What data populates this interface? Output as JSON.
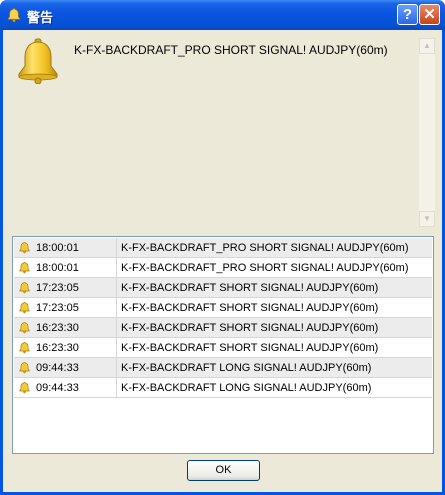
{
  "window": {
    "title": "警告",
    "help_glyph": "?",
    "close_glyph": "✕"
  },
  "alert": {
    "icon": "bell-icon",
    "message": "K-FX-BACKDRAFT_PRO SHORT SIGNAL! AUDJPY(60m)"
  },
  "log": {
    "rows": [
      {
        "time": "18:00:01",
        "text": "K-FX-BACKDRAFT_PRO SHORT SIGNAL! AUDJPY(60m)"
      },
      {
        "time": "18:00:01",
        "text": "K-FX-BACKDRAFT_PRO SHORT SIGNAL! AUDJPY(60m)"
      },
      {
        "time": "17:23:05",
        "text": "K-FX-BACKDRAFT SHORT SIGNAL! AUDJPY(60m)"
      },
      {
        "time": "17:23:05",
        "text": "K-FX-BACKDRAFT SHORT SIGNAL! AUDJPY(60m)"
      },
      {
        "time": "16:23:30",
        "text": "K-FX-BACKDRAFT SHORT SIGNAL! AUDJPY(60m)"
      },
      {
        "time": "16:23:30",
        "text": "K-FX-BACKDRAFT SHORT SIGNAL! AUDJPY(60m)"
      },
      {
        "time": "09:44:33",
        "text": "K-FX-BACKDRAFT LONG SIGNAL! AUDJPY(60m)"
      },
      {
        "time": "09:44:33",
        "text": "K-FX-BACKDRAFT LONG SIGNAL! AUDJPY(60m)"
      }
    ]
  },
  "buttons": {
    "ok_label": "OK"
  },
  "colors": {
    "titlebar": "#0a55e0",
    "client_bg": "#ece9d8",
    "bell": "#f0c020"
  }
}
